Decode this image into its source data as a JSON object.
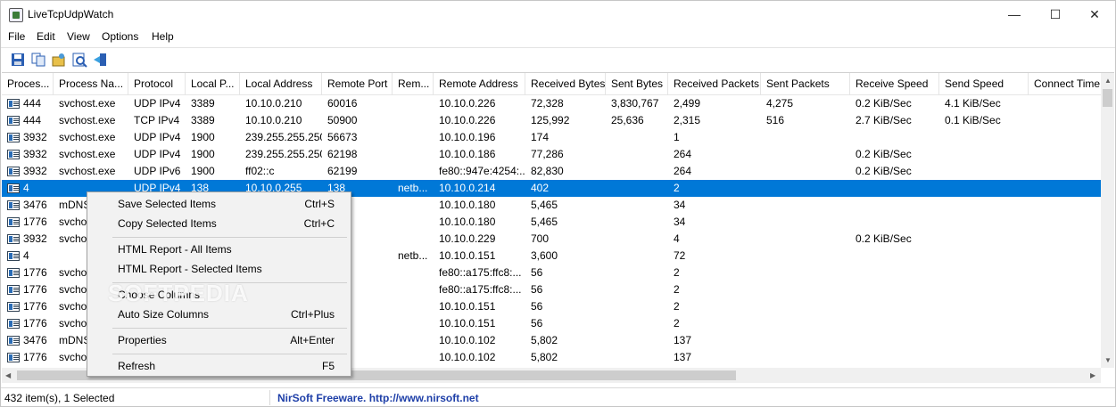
{
  "window": {
    "title": "LiveTcpUdpWatch"
  },
  "menubar": [
    "File",
    "Edit",
    "View",
    "Options",
    "Help"
  ],
  "toolbar": [
    "save-icon",
    "copy-icon",
    "html-report-icon",
    "properties-icon",
    "exit-icon"
  ],
  "columns": [
    "Proces...",
    "Process Na...",
    "Protocol",
    "Local P...",
    "Local Address",
    "Remote Port",
    "Rem...",
    "Remote Address",
    "Received Bytes",
    "Sent Bytes",
    "Received Packets",
    "Sent Packets",
    "Receive Speed",
    "Send Speed",
    "Connect Time"
  ],
  "rows": [
    [
      "444",
      "svchost.exe",
      "UDP IPv4",
      "3389",
      "10.10.0.210",
      "60016",
      "",
      "10.10.0.226",
      "72,328",
      "3,830,767",
      "2,499",
      "4,275",
      "0.2 KiB/Sec",
      "4.1 KiB/Sec",
      ""
    ],
    [
      "444",
      "svchost.exe",
      "TCP IPv4",
      "3389",
      "10.10.0.210",
      "50900",
      "",
      "10.10.0.226",
      "125,992",
      "25,636",
      "2,315",
      "516",
      "2.7 KiB/Sec",
      "0.1 KiB/Sec",
      ""
    ],
    [
      "3932",
      "svchost.exe",
      "UDP IPv4",
      "1900",
      "239.255.255.250",
      "56673",
      "",
      "10.10.0.196",
      "174",
      "",
      "1",
      "",
      "",
      "",
      ""
    ],
    [
      "3932",
      "svchost.exe",
      "UDP IPv4",
      "1900",
      "239.255.255.250",
      "62198",
      "",
      "10.10.0.186",
      "77,286",
      "",
      "264",
      "",
      "0.2 KiB/Sec",
      "",
      ""
    ],
    [
      "3932",
      "svchost.exe",
      "UDP IPv6",
      "1900",
      "ff02::c",
      "62199",
      "",
      "fe80::947e:4254:...",
      "82,830",
      "",
      "264",
      "",
      "0.2 KiB/Sec",
      "",
      ""
    ],
    [
      "4",
      "",
      "UDP IPv4",
      "138",
      "10.10.0.255",
      "138",
      "netb...",
      "10.10.0.214",
      "402",
      "",
      "2",
      "",
      "",
      "",
      ""
    ],
    [
      "3476",
      "mDNS",
      "",
      "",
      "",
      "",
      "",
      "10.10.0.180",
      "5,465",
      "",
      "34",
      "",
      "",
      "",
      ""
    ],
    [
      "1776",
      "svcho",
      "",
      "",
      "",
      "",
      "",
      "10.10.0.180",
      "5,465",
      "",
      "34",
      "",
      "",
      "",
      ""
    ],
    [
      "3932",
      "svcho",
      "",
      "",
      "",
      "5",
      "",
      "10.10.0.229",
      "700",
      "",
      "4",
      "",
      "0.2 KiB/Sec",
      "",
      ""
    ],
    [
      "4",
      "",
      "",
      "",
      "",
      "",
      "netb...",
      "10.10.0.151",
      "3,600",
      "",
      "72",
      "",
      "",
      "",
      ""
    ],
    [
      "1776",
      "svcho",
      "",
      "",
      "",
      "3",
      "",
      "fe80::a175:ffc8:...",
      "56",
      "",
      "2",
      "",
      "",
      "",
      ""
    ],
    [
      "1776",
      "svcho",
      "",
      "",
      "",
      "5",
      "",
      "fe80::a175:ffc8:...",
      "56",
      "",
      "2",
      "",
      "",
      "",
      ""
    ],
    [
      "1776",
      "svcho",
      "",
      "",
      "",
      "3",
      "",
      "10.10.0.151",
      "56",
      "",
      "2",
      "",
      "",
      "",
      ""
    ],
    [
      "1776",
      "svcho",
      "",
      "",
      "",
      "5",
      "",
      "10.10.0.151",
      "56",
      "",
      "2",
      "",
      "",
      "",
      ""
    ],
    [
      "3476",
      "mDNS",
      "",
      "",
      "",
      "",
      "",
      "10.10.0.102",
      "5,802",
      "",
      "137",
      "",
      "",
      "",
      ""
    ],
    [
      "1776",
      "svcho",
      "",
      "",
      "",
      "",
      "",
      "10.10.0.102",
      "5,802",
      "",
      "137",
      "",
      "",
      "",
      ""
    ]
  ],
  "selected_row_index": 5,
  "context_menu": [
    {
      "label": "Save Selected Items",
      "shortcut": "Ctrl+S"
    },
    {
      "label": "Copy Selected Items",
      "shortcut": "Ctrl+C"
    },
    {
      "label": "HTML Report - All Items",
      "shortcut": ""
    },
    {
      "label": "HTML Report - Selected Items",
      "shortcut": ""
    },
    {
      "label": "Choose Columns",
      "shortcut": ""
    },
    {
      "label": "Auto Size Columns",
      "shortcut": "Ctrl+Plus"
    },
    {
      "label": "Properties",
      "shortcut": "Alt+Enter"
    },
    {
      "label": "Refresh",
      "shortcut": "F5"
    }
  ],
  "watermark": "SOFTPEDIA",
  "status": {
    "count": "432 item(s), 1 Selected",
    "link": "NirSoft Freeware.  http://www.nirsoft.net"
  },
  "colors": {
    "selection": "#0078d7",
    "link": "#1e3fa8"
  }
}
